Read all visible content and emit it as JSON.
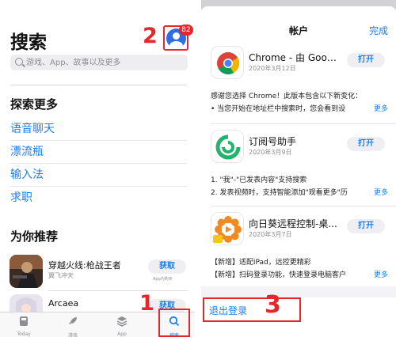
{
  "left": {
    "title": "搜索",
    "search_placeholder": "游戏、App、故事以及更多",
    "account_badge": "82",
    "explore_title": "探索更多",
    "explore_items": [
      "语音聊天",
      "漂流瓶",
      "输入法",
      "求职"
    ],
    "recommend_title": "为你推荐",
    "apps": [
      {
        "name": "穿越火线:枪战王者",
        "subtitle": "翼飞冲天",
        "button": "获取",
        "note": "App内购买"
      },
      {
        "name": "Arcaea",
        "subtitle": "",
        "button": "获取",
        "note": ""
      }
    ],
    "tabs": [
      {
        "label": "Today",
        "icon": "today-icon"
      },
      {
        "label": "游戏",
        "icon": "rocket-icon"
      },
      {
        "label": "App",
        "icon": "layers-icon"
      },
      {
        "label": "",
        "icon": ""
      },
      {
        "label": "搜索",
        "icon": "search-icon"
      }
    ]
  },
  "right": {
    "title": "帐户",
    "done": "完成",
    "updates": [
      {
        "name": "Chrome - 由 Google...",
        "date": "2020年3月12日",
        "button": "打开",
        "lines": [
          "感谢您选择 Chrome！此版本包含以下新变化：",
          "• 当您开始在地址栏中搜索时，您会看到设"
        ],
        "more": "更多"
      },
      {
        "name": "订阅号助手",
        "date": "2020年3月9日",
        "button": "打开",
        "lines": [
          "1. \"我\"-\"已发表内容\"支持搜索",
          "2. 发表视频时，支持智能添加\"观看更多\"历"
        ],
        "more": "更多"
      },
      {
        "name": "向日葵远程控制-桌...",
        "date": "2020年3月7日",
        "button": "打开",
        "lines": [
          "【新增】适配iPad，远控更精彩",
          "【新增】扫码登录功能，快速登录电脑客户"
        ],
        "more": "更多"
      }
    ],
    "logout": "退出登录"
  },
  "annotations": {
    "step1": "1",
    "step2": "2",
    "step3": "3"
  },
  "colors": {
    "accent": "#1a7ef0",
    "annotation": "#e5262a"
  }
}
